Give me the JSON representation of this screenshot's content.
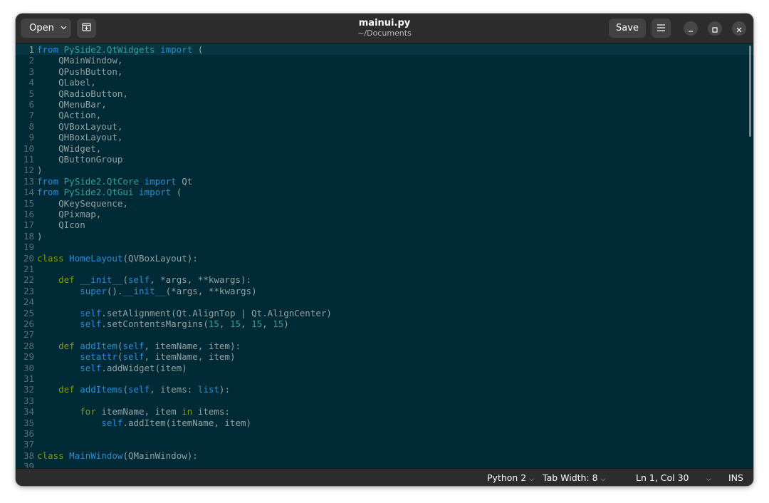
{
  "header": {
    "open_label": "Open",
    "title": "mainui.py",
    "subtitle": "~/Documents",
    "save_label": "Save"
  },
  "icons": {
    "open_dropdown": "chevron-down-icon",
    "new_tab": "new-tab-icon",
    "menu": "hamburger-menu-icon",
    "minimize": "minimize-icon",
    "maximize": "maximize-icon",
    "close": "close-icon"
  },
  "colors": {
    "editor_bg": "#002b36",
    "current_line_bg": "#073642",
    "text": "#93a1a1",
    "keyword": "#859900",
    "import_keyword": "#268bd2",
    "module": "#2aa198",
    "function": "#268bd2",
    "number": "#2aa198",
    "line_number": "#586e75"
  },
  "editor": {
    "current_line": 1,
    "lines": [
      [
        {
          "t": "from",
          "c": "kw2"
        },
        {
          "t": " "
        },
        {
          "t": "PySide2.QtWidgets",
          "c": "mod"
        },
        {
          "t": " "
        },
        {
          "t": "import",
          "c": "kw2"
        },
        {
          "t": " ("
        }
      ],
      [
        {
          "t": "    QMainWindow,"
        }
      ],
      [
        {
          "t": "    QPushButton,"
        }
      ],
      [
        {
          "t": "    QLabel,"
        }
      ],
      [
        {
          "t": "    QRadioButton,"
        }
      ],
      [
        {
          "t": "    QMenuBar,"
        }
      ],
      [
        {
          "t": "    QAction,"
        }
      ],
      [
        {
          "t": "    QVBoxLayout,"
        }
      ],
      [
        {
          "t": "    QHBoxLayout,"
        }
      ],
      [
        {
          "t": "    QWidget,"
        }
      ],
      [
        {
          "t": "    QButtonGroup"
        }
      ],
      [
        {
          "t": ")"
        }
      ],
      [
        {
          "t": "from",
          "c": "kw2"
        },
        {
          "t": " "
        },
        {
          "t": "PySide2.QtCore",
          "c": "mod"
        },
        {
          "t": " "
        },
        {
          "t": "import",
          "c": "kw2"
        },
        {
          "t": " Qt"
        }
      ],
      [
        {
          "t": "from",
          "c": "kw2"
        },
        {
          "t": " "
        },
        {
          "t": "PySide2.QtGui",
          "c": "mod"
        },
        {
          "t": " "
        },
        {
          "t": "import",
          "c": "kw2"
        },
        {
          "t": " ("
        }
      ],
      [
        {
          "t": "    QKeySequence,"
        }
      ],
      [
        {
          "t": "    QPixmap,"
        }
      ],
      [
        {
          "t": "    QIcon"
        }
      ],
      [
        {
          "t": ")"
        }
      ],
      [],
      [
        {
          "t": "class",
          "c": "kw"
        },
        {
          "t": " "
        },
        {
          "t": "HomeLayout",
          "c": "fn"
        },
        {
          "t": "(QVBoxLayout):"
        }
      ],
      [],
      [
        {
          "t": "    "
        },
        {
          "t": "def",
          "c": "kw"
        },
        {
          "t": " "
        },
        {
          "t": "__init__",
          "c": "fn"
        },
        {
          "t": "("
        },
        {
          "t": "self",
          "c": "fn"
        },
        {
          "t": ", *args, **kwargs):"
        }
      ],
      [
        {
          "t": "        "
        },
        {
          "t": "super",
          "c": "fn"
        },
        {
          "t": "()."
        },
        {
          "t": "__init__",
          "c": "fn"
        },
        {
          "t": "(*args, **kwargs)"
        }
      ],
      [],
      [
        {
          "t": "        "
        },
        {
          "t": "self",
          "c": "fn"
        },
        {
          "t": ".setAlignment(Qt.AlignTop | Qt.AlignCenter)"
        }
      ],
      [
        {
          "t": "        "
        },
        {
          "t": "self",
          "c": "fn"
        },
        {
          "t": ".setContentsMargins("
        },
        {
          "t": "15",
          "c": "num"
        },
        {
          "t": ", "
        },
        {
          "t": "15",
          "c": "num"
        },
        {
          "t": ", "
        },
        {
          "t": "15",
          "c": "num"
        },
        {
          "t": ", "
        },
        {
          "t": "15",
          "c": "num"
        },
        {
          "t": ")"
        }
      ],
      [],
      [
        {
          "t": "    "
        },
        {
          "t": "def",
          "c": "kw"
        },
        {
          "t": " "
        },
        {
          "t": "addItem",
          "c": "fn"
        },
        {
          "t": "("
        },
        {
          "t": "self",
          "c": "fn"
        },
        {
          "t": ", itemName, item):"
        }
      ],
      [
        {
          "t": "        "
        },
        {
          "t": "setattr",
          "c": "fn"
        },
        {
          "t": "("
        },
        {
          "t": "self",
          "c": "fn"
        },
        {
          "t": ", itemName, item)"
        }
      ],
      [
        {
          "t": "        "
        },
        {
          "t": "self",
          "c": "fn"
        },
        {
          "t": ".addWidget(item)"
        }
      ],
      [],
      [
        {
          "t": "    "
        },
        {
          "t": "def",
          "c": "kw"
        },
        {
          "t": " "
        },
        {
          "t": "addItems",
          "c": "fn"
        },
        {
          "t": "("
        },
        {
          "t": "self",
          "c": "fn"
        },
        {
          "t": ", items: "
        },
        {
          "t": "list",
          "c": "fn"
        },
        {
          "t": "):"
        }
      ],
      [],
      [
        {
          "t": "        "
        },
        {
          "t": "for",
          "c": "kw"
        },
        {
          "t": " itemName, item "
        },
        {
          "t": "in",
          "c": "kw"
        },
        {
          "t": " items:"
        }
      ],
      [
        {
          "t": "            "
        },
        {
          "t": "self",
          "c": "fn"
        },
        {
          "t": ".addItem(itemName, item)"
        }
      ],
      [],
      [],
      [
        {
          "t": "class",
          "c": "kw"
        },
        {
          "t": " "
        },
        {
          "t": "MainWindow",
          "c": "fn"
        },
        {
          "t": "(QMainWindow):"
        }
      ],
      []
    ]
  },
  "statusbar": {
    "language": "Python 2",
    "tab_width": "Tab Width: 8",
    "position": "Ln 1, Col 30",
    "mode": "INS"
  }
}
